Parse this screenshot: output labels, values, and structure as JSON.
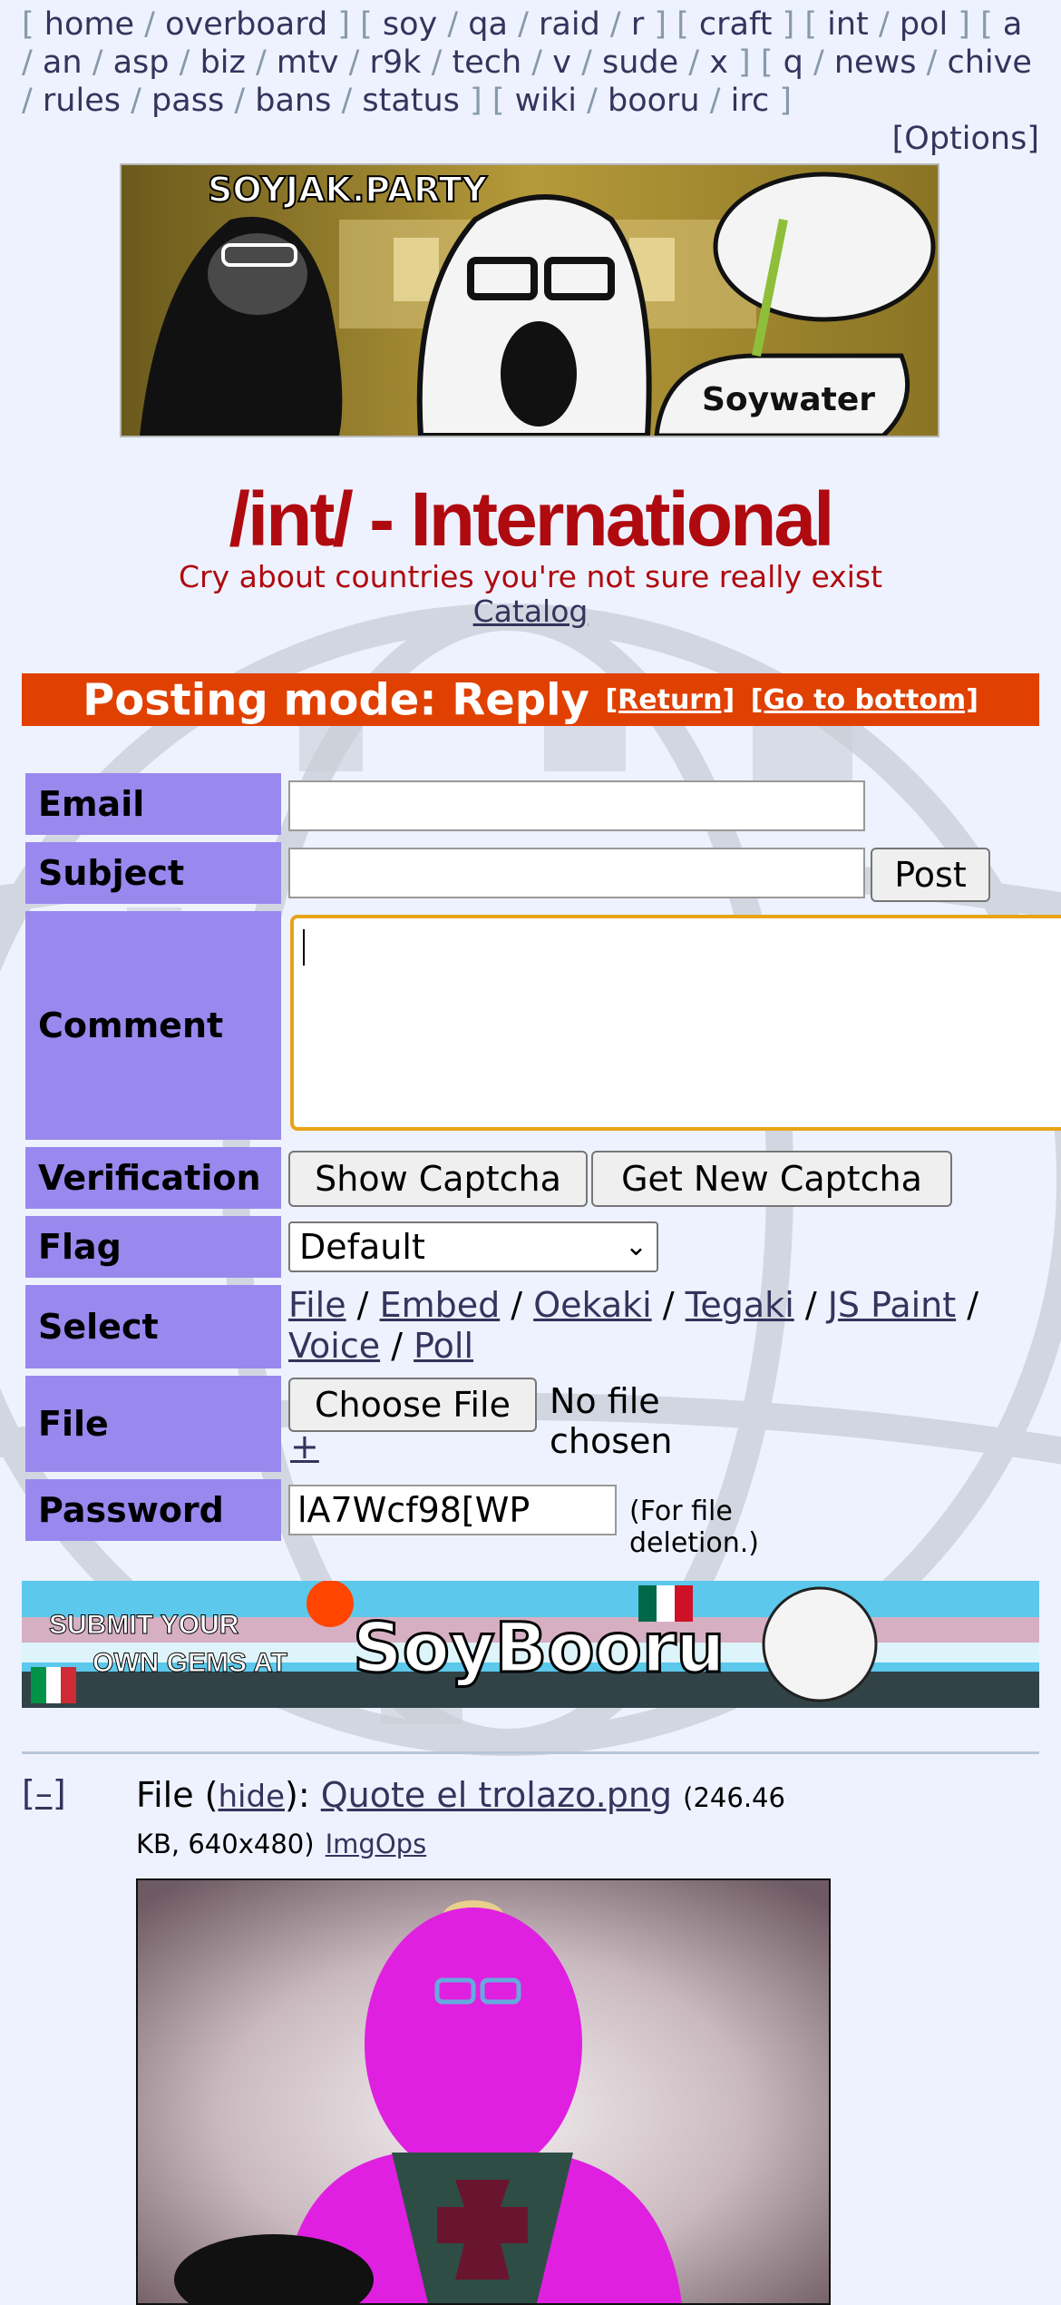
{
  "nav": {
    "groups": [
      [
        "home",
        "overboard"
      ],
      [
        "soy",
        "qa",
        "raid",
        "r"
      ],
      [
        "craft"
      ],
      [
        "int",
        "pol"
      ],
      [
        "a",
        "an",
        "asp",
        "biz",
        "mtv",
        "r9k",
        "tech",
        "v",
        "sude",
        "x"
      ],
      [
        "q",
        "news",
        "chive",
        "rules",
        "pass",
        "bans",
        "status"
      ],
      [
        "wiki",
        "booru",
        "irc"
      ]
    ],
    "options": "[Options]"
  },
  "banner": {
    "site": "SOYJAK.PARTY",
    "cup_text": "Soywater"
  },
  "board": {
    "title": "/int/ - International",
    "subtitle": "Cry about countries you're not sure really exist",
    "catalog": "Catalog"
  },
  "mode_bar": {
    "text": "Posting mode: Reply",
    "return": "[Return]",
    "bottom": "[Go to bottom]"
  },
  "form": {
    "email_label": "Email",
    "subject_label": "Subject",
    "post_button": "Post",
    "comment_label": "Comment",
    "verification_label": "Verification",
    "show_captcha": "Show Captcha",
    "new_captcha": "Get New Captcha",
    "flag_label": "Flag",
    "flag_value": "Default",
    "select_label": "Select",
    "select_options": [
      "File",
      "Embed",
      "Oekaki",
      "Tegaki",
      "JS Paint",
      "Voice",
      "Poll"
    ],
    "file_label": "File",
    "choose_file": "Choose File",
    "no_file": "No file chosen",
    "add_file": "+",
    "password_label": "Password",
    "password_value": "lA7Wcf98[WP",
    "password_note": "(For file deletion.)"
  },
  "ad": {
    "line1": "SUBMIT YOUR",
    "line2": "OWN GEMS AT",
    "brand": "SoyBooru"
  },
  "post": {
    "collapse": "[–]",
    "file_word": "File",
    "hide": "hide",
    "filename": "Quote el trolazo.png",
    "download_glyph": "",
    "meta1": "(246.46",
    "meta2": "KB, 640x480)",
    "imgops": "ImgOps"
  },
  "colors": {
    "background": "#eef2ff",
    "title_red": "#af0a0f",
    "mode_bar": "#e04000",
    "label_purple": "#9988ee",
    "link": "#34345c"
  }
}
